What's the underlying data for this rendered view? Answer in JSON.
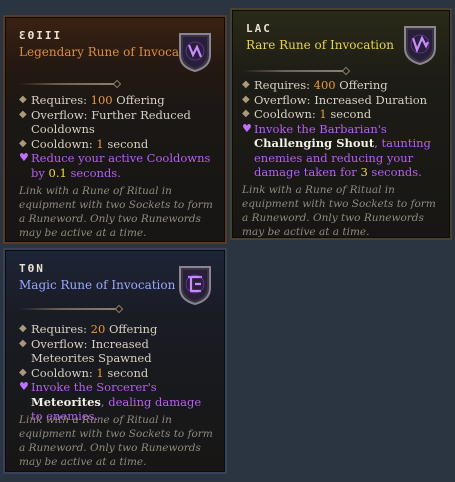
{
  "cards": {
    "legendary": {
      "name": "ƐΘIII",
      "type": "Legendary Rune of Invocation",
      "icon": "legendary-rune-icon",
      "requires_label": "Requires: ",
      "requires_value": "100",
      "requires_suffix": " Offering",
      "overflow": "Overflow: Further Reduced Cooldowns",
      "cooldown_label": "Cooldown: ",
      "cooldown_value": "1",
      "cooldown_suffix": " second",
      "effect_prefix": "Reduce your active Cooldowns by ",
      "effect_value": "0.1",
      "effect_suffix": " seconds.",
      "flavor": "Link with a Rune of Ritual in equipment with two Sockets to form a Runeword. Only two Runewords may be active at a time."
    },
    "rare": {
      "name": "LAC",
      "type": "Rare Rune of Invocation",
      "icon": "rare-rune-icon",
      "requires_label": "Requires: ",
      "requires_value": "400",
      "requires_suffix": " Offering",
      "overflow": "Overflow: Increased Duration",
      "cooldown_label": "Cooldown: ",
      "cooldown_value": "1",
      "cooldown_suffix": " second",
      "effect_prefix": "Invoke the Barbarian's ",
      "effect_skill": "Challenging Shout",
      "effect_middle": ", taunting enemies and reducing your damage taken for ",
      "effect_value": "3",
      "effect_suffix": " seconds.",
      "flavor": "Link with a Rune of Ritual in equipment with two Sockets to form a Runeword. Only two Runewords may be active at a time."
    },
    "magic": {
      "name": "TΘN",
      "type": "Magic Rune of Invocation",
      "icon": "magic-rune-icon",
      "requires_label": "Requires: ",
      "requires_value": "20",
      "requires_suffix": " Offering",
      "overflow": "Overflow: Increased Meteorites Spawned",
      "cooldown_label": "Cooldown: ",
      "cooldown_value": "1",
      "cooldown_suffix": " second",
      "effect_prefix": "Invoke the Sorcerer's ",
      "effect_skill": "Meteorites",
      "effect_suffix": ", dealing damage to enemies.",
      "flavor": "Link with a Rune of Ritual in equipment with two Sockets to form a Runeword. Only two Runewords may be active at a time."
    }
  },
  "colors": {
    "legendary": "#e08a3c",
    "rare": "#e9d24a",
    "magic": "#9aa6ff",
    "highlight": "#e89a3a",
    "effect": "#b65ff2"
  }
}
